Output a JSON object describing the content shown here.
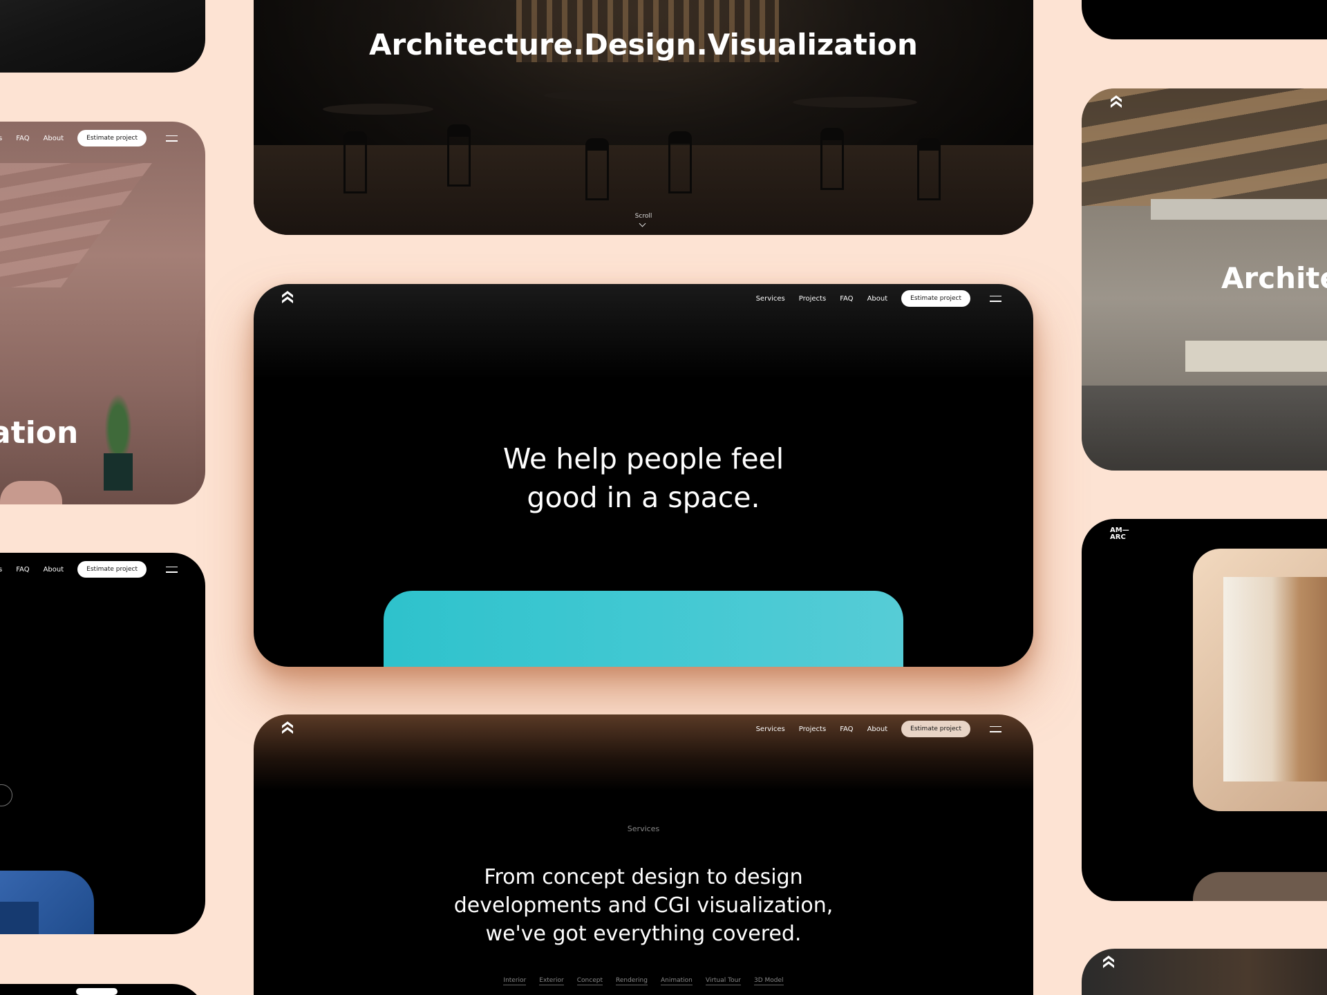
{
  "colors": {
    "background": "#fde3d3",
    "card": "#000000",
    "teal_block": "#3cc6d0",
    "pill": "#ffffff",
    "pill_tan": "#e8d4c6"
  },
  "nav": {
    "items": [
      "Services",
      "Projects",
      "FAQ",
      "About"
    ],
    "cta": "Estimate project",
    "menu_icon": "hamburger-icon",
    "logo_icon": "chevron-stack-logo-icon"
  },
  "left_cards": {
    "l2": {
      "nav_visible": [
        "s",
        "FAQ",
        "About"
      ],
      "cta": "Estimate project",
      "headline_fragment": "ation"
    },
    "l3": {
      "nav_visible": [
        "s",
        "FAQ",
        "About"
      ],
      "cta": "Estimate project"
    }
  },
  "top_card": {
    "headline": "Architecture.Design.Visualization",
    "scroll_label": "Scroll"
  },
  "hero_card": {
    "headline_line1": "We help people feel",
    "headline_line2": "good in a space."
  },
  "services_card": {
    "eyebrow": "Services",
    "body_line1": "From concept design to design",
    "body_line2": "developments and CGI visualization,",
    "body_line3": "we've got everything covered.",
    "tags": [
      "Interior",
      "Exterior",
      "Concept",
      "Rendering",
      "Animation",
      "Virtual Tour",
      "3D Model"
    ]
  },
  "right_cards": {
    "r2": {
      "headline_fragment": "Archite"
    },
    "r3": {
      "wordmark_line1": "AM—",
      "wordmark_line2": "ARC"
    }
  }
}
